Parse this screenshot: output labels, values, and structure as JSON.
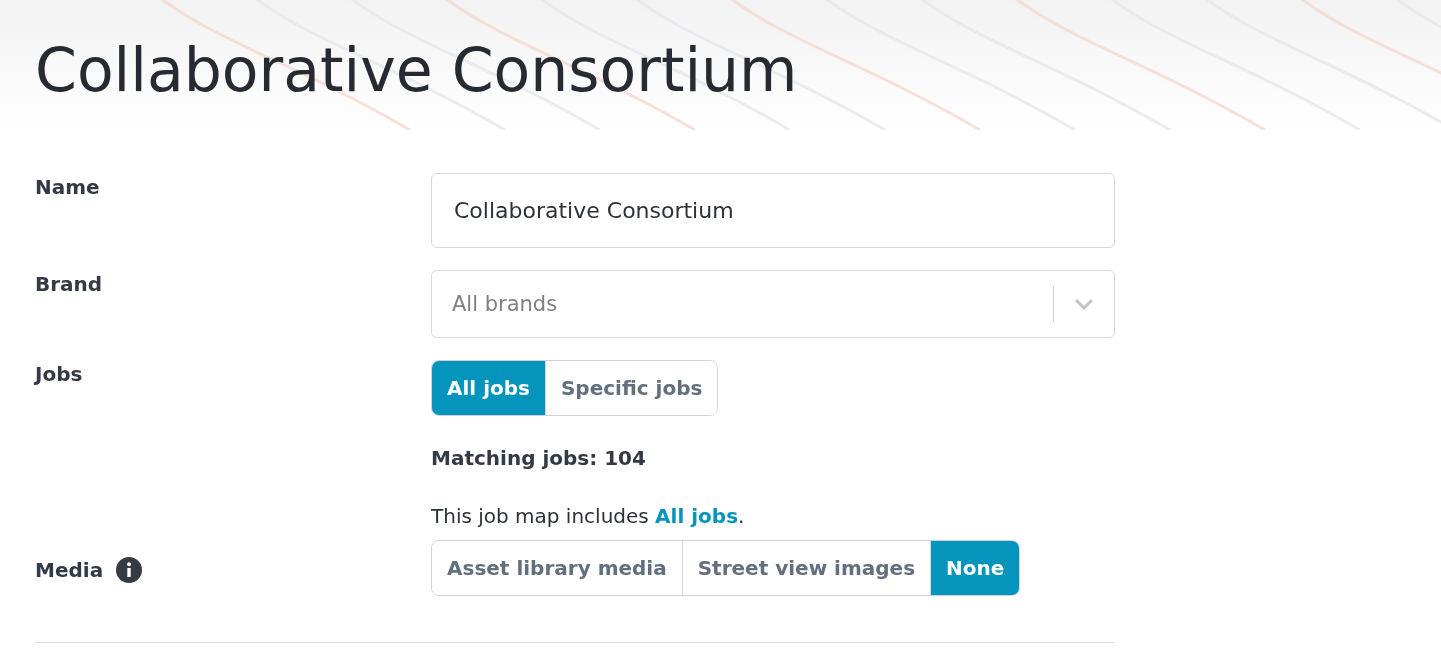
{
  "title": "Collaborative Consortium",
  "fields": [
    {
      "kind": "text",
      "label": "Name",
      "value": "Collaborative Consortium"
    },
    {
      "kind": "select",
      "label": "Brand",
      "placeholder": "All brands"
    },
    {
      "kind": "segmented",
      "label": "Jobs",
      "options": [
        {
          "label": "All jobs",
          "selected": true
        },
        {
          "label": "Specific jobs",
          "selected": false
        }
      ],
      "matching": "Matching jobs: 104",
      "summary": {
        "prefix": "This job map includes",
        "link": "All jobs",
        "suffix": "."
      }
    },
    {
      "kind": "segmented",
      "label": "Media",
      "info": true,
      "options": [
        {
          "label": "Asset library media",
          "selected": false
        },
        {
          "label": "Street view images",
          "selected": false
        },
        {
          "label": "None",
          "selected": true
        }
      ]
    }
  ]
}
